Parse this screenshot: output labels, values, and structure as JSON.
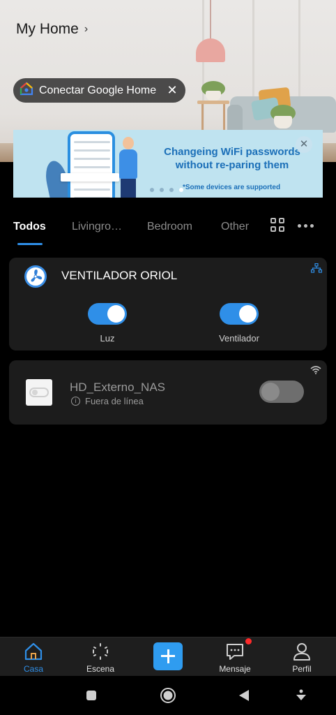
{
  "header": {
    "home_title": "My Home",
    "chevron": "›"
  },
  "google_chip": {
    "icon": "google-home-icon",
    "label": "Conectar Google Home",
    "close": "✕"
  },
  "banner": {
    "headline_line1": "Changeing WiFi passwords",
    "headline_line2": "without re-paring them",
    "note": "*Some devices are supported",
    "close": "✕",
    "pagination": {
      "count": 4,
      "active_index": 3
    }
  },
  "tabs": {
    "items": [
      {
        "label": "Todos",
        "active": true
      },
      {
        "label": "Livingro…",
        "active": false
      },
      {
        "label": "Bedroom",
        "active": false
      },
      {
        "label": "Other",
        "active": false
      }
    ]
  },
  "devices": [
    {
      "name": "VENTILADOR ORIOL",
      "icon": "fan-icon",
      "status_icon": "network-icon",
      "switches": [
        {
          "label": "Luz",
          "on": true
        },
        {
          "label": "Ventilador",
          "on": true
        }
      ]
    },
    {
      "name": "HD_Externo_NAS",
      "icon": "switch-device-icon",
      "status_icon": "wifi-icon",
      "status_text": "Fuera de línea",
      "switch_on": false
    }
  ],
  "bottom_nav": {
    "items": [
      {
        "label": "Casa",
        "icon": "home-icon",
        "active": true
      },
      {
        "label": "Escena",
        "icon": "scene-icon",
        "active": false
      },
      {
        "label": "Mensaje",
        "icon": "message-icon",
        "active": false,
        "badge": true
      },
      {
        "label": "Perfil",
        "icon": "profile-icon",
        "active": false
      }
    ],
    "add_icon": "plus-icon"
  },
  "system_nav": [
    "recents-icon",
    "home-circle-icon",
    "back-icon",
    "keyboard-hide-icon"
  ],
  "colors": {
    "accent": "#2f8fe8",
    "background": "#000000",
    "card": "#1c1c1c",
    "badge": "#ff2a2a"
  }
}
